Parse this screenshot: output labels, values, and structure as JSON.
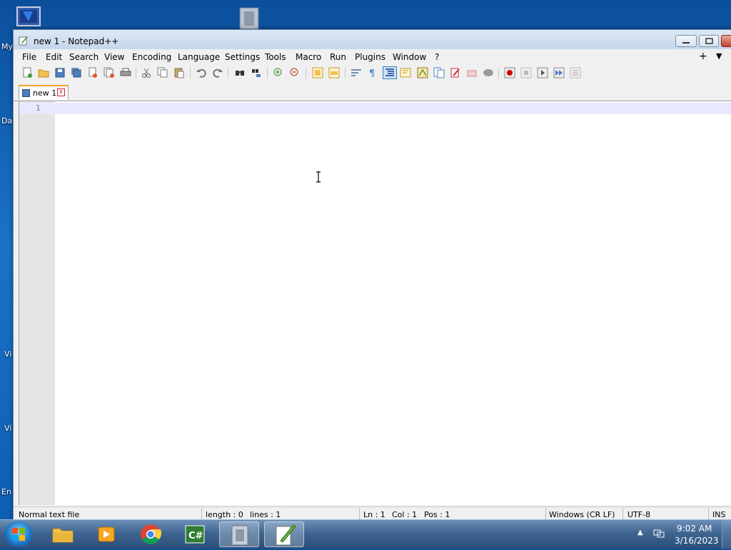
{
  "desktop": {
    "labels": [
      "My",
      "Da",
      "Vi",
      "Vi",
      "En"
    ]
  },
  "window": {
    "title": "new 1 - Notepad++"
  },
  "menu": {
    "items": [
      "File",
      "Edit",
      "Search",
      "View",
      "Encoding",
      "Language",
      "Settings",
      "Tools",
      "Macro",
      "Run",
      "Plugins",
      "Window",
      "?"
    ],
    "plus": "+",
    "down": "▼"
  },
  "toolbar": {
    "icons": [
      "new-file-icon",
      "open-file-icon",
      "save-icon",
      "save-all-icon",
      "close-icon",
      "close-all-icon",
      "print-icon",
      "cut-icon",
      "copy-icon",
      "paste-icon",
      "undo-icon",
      "redo-icon",
      "find-icon",
      "replace-icon",
      "zoom-in-icon",
      "zoom-out-icon",
      "sync-vertical-icon",
      "sync-horizontal-icon",
      "word-wrap-icon",
      "show-all-chars-icon",
      "indent-guide-icon",
      "user-language-icon",
      "doc-map-icon",
      "function-list-icon",
      "folder-workspace-icon",
      "monitoring-icon",
      "macro-record-icon",
      "macro-stop-icon",
      "macro-play-icon",
      "macro-run-multiple-icon",
      "macro-save-icon"
    ]
  },
  "tabs": [
    {
      "label": "new 1",
      "close": "x"
    }
  ],
  "editor": {
    "line_number": "1"
  },
  "status": {
    "file_type": "Normal text file",
    "length": "length : 0",
    "lines": "lines : 1",
    "ln": "Ln : 1",
    "col": "Col : 1",
    "pos": "Pos : 1",
    "eol": "Windows (CR LF)",
    "encoding": "UTF-8",
    "mode": "INS"
  },
  "taskbar": {
    "apps": [
      "explorer",
      "media-player",
      "chrome",
      "csharp-ide",
      "file-archive",
      "notepadpp"
    ],
    "tray_arrow": "▲",
    "time": "9:02 AM",
    "date": "3/16/2023"
  }
}
